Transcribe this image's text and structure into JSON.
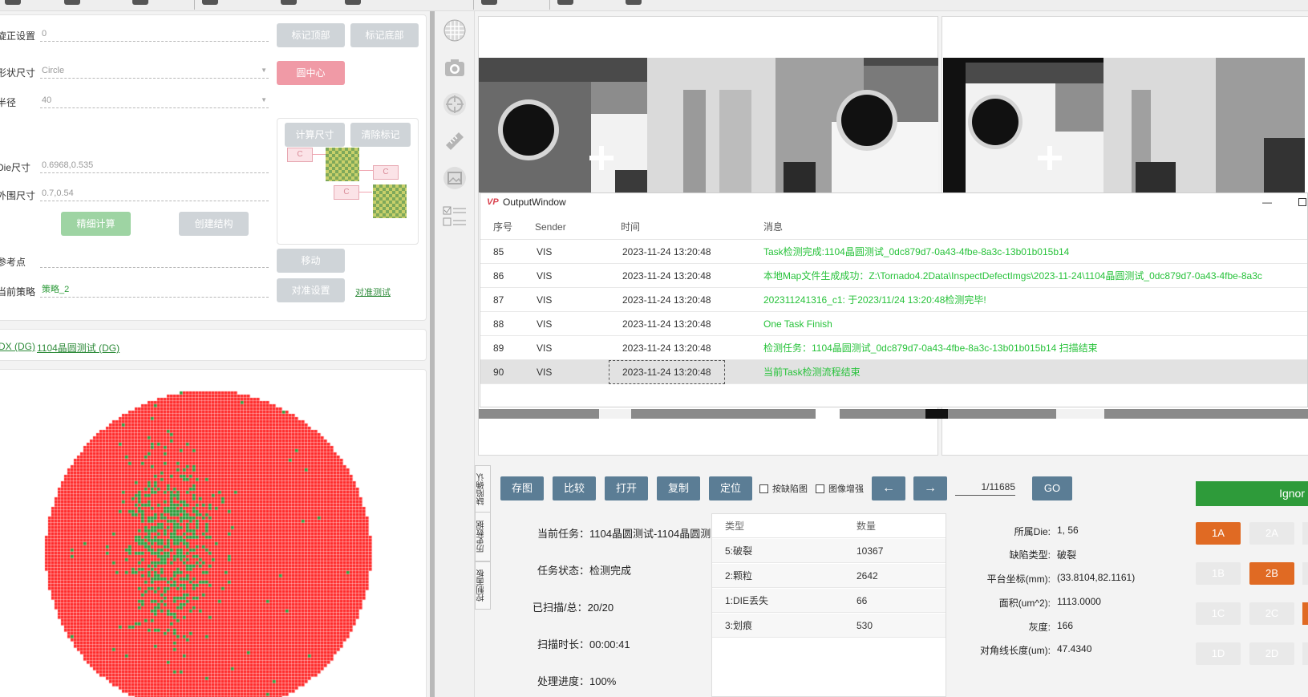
{
  "left_panel": {
    "rotation_label": "旋正设置",
    "rotation_value": "0",
    "btn_mark_top": "标记顶部",
    "btn_mark_bottom": "标记底部",
    "shape_label": "形状尺寸",
    "shape_value": "Circle",
    "btn_circle_center": "圆中心",
    "radius_label": "半径",
    "radius_value": "40",
    "die_size_label": "Die尺寸",
    "die_size_value": "0.6968,0.535",
    "outer_size_label": "外围尺寸",
    "outer_size_value": "0.7,0.54",
    "btn_fine_calc": "精细计算",
    "btn_create_struct": "创建结构",
    "btn_calc_size": "计算尺寸",
    "btn_clear_mark": "清除标记",
    "tag_c": "C",
    "ref_point_label": "参考点",
    "btn_move": "移动",
    "strategy_label": "当前策略",
    "strategy_value": "策略_2",
    "btn_align_settings": "对准设置",
    "link_align_test": "对准测试",
    "breadcrumb_1": "DX (DG)",
    "breadcrumb_2": "1104晶圆测试 (DG)"
  },
  "side_tabs": [
    "缺陷确认",
    "历史数据",
    "控制面板"
  ],
  "output_window": {
    "title": "OutputWindow",
    "minimize_glyph": "—",
    "columns": [
      "序号",
      "Sender",
      "时间",
      "消息"
    ],
    "rows": [
      {
        "no": "85",
        "sender": "VIS",
        "time": "2023-11-24 13:20:48",
        "message": "Task检测完成:1104晶圆测试_0dc879d7-0a43-4fbe-8a3c-13b01b015b14"
      },
      {
        "no": "86",
        "sender": "VIS",
        "time": "2023-11-24 13:20:48",
        "message": "本地Map文件生成成功：Z:\\Tornado4.2Data\\InspectDefectImgs\\2023-11-24\\1104晶圆测试_0dc879d7-0a43-4fbe-8a3c"
      },
      {
        "no": "87",
        "sender": "VIS",
        "time": "2023-11-24 13:20:48",
        "message": "202311241316_c1: 于2023/11/24 13:20:48检测完毕!"
      },
      {
        "no": "88",
        "sender": "VIS",
        "time": "2023-11-24 13:20:48",
        "message": "One Task Finish"
      },
      {
        "no": "89",
        "sender": "VIS",
        "time": "2023-11-24 13:20:48",
        "message": "检测任务：1104晶圆测试_0dc879d7-0a43-4fbe-8a3c-13b01b015b14 扫描结束"
      },
      {
        "no": "90",
        "sender": "VIS",
        "time": "2023-11-24 13:20:48",
        "message": "当前Task检测流程结束"
      }
    ]
  },
  "toolbar": {
    "save_image": "存图",
    "compare": "比较",
    "open": "打开",
    "copy": "复制",
    "locate": "定位",
    "by_defect_label": "按缺陷图",
    "enhance_label": "图像增强",
    "prev_arrow": "←",
    "next_arrow": "→",
    "page_value": "1/11685",
    "go": "GO",
    "ignore": "Ignor"
  },
  "task_info": {
    "current_task": "当前任务：1104晶圆测试-1104晶圆测",
    "task_status": "任务状态：检测完成",
    "scanned_total": "已扫描/总：20/20",
    "scan_duration": "扫描时长：00:00:41",
    "progress": "处理进度：100%"
  },
  "defect_table": {
    "col_type": "类型",
    "col_count": "数量",
    "rows": [
      {
        "type": "5:破裂",
        "count": "10367"
      },
      {
        "type": "2:颗粒",
        "count": "2642"
      },
      {
        "type": "1:DIE丢失",
        "count": "66"
      },
      {
        "type": "3:划痕",
        "count": "530"
      }
    ]
  },
  "defect_detail": {
    "die_label": "所属Die:",
    "die_value": "1, 56",
    "type_label": "缺陷类型:",
    "type_value": "破裂",
    "platform_label": "平台坐标(mm):",
    "platform_value": "(33.8104,82.1161)",
    "area_label": "面积(um^2):",
    "area_value": "1113.0000",
    "gray_label": "灰度:",
    "gray_value": "166",
    "diag_label": "对角线长度(um):",
    "diag_value": "47.4340"
  },
  "grade_buttons": [
    "1A",
    "2A",
    "1B",
    "2B",
    "1C",
    "2C",
    "1D",
    "2D"
  ],
  "colors": {
    "wafer_fail": "#ff2a2a",
    "wafer_pass": "#2e9b3a",
    "message_green": "#27c23a",
    "toolbar_button": "#5b7d95",
    "grade_active": "#e06a23",
    "ignore_green": "#2e9b3a"
  },
  "icons": [
    "grid-icon",
    "camera-icon",
    "crosshair-icon",
    "ruler-icon",
    "image-icon",
    "checklist-icon",
    "logo-icon"
  ]
}
